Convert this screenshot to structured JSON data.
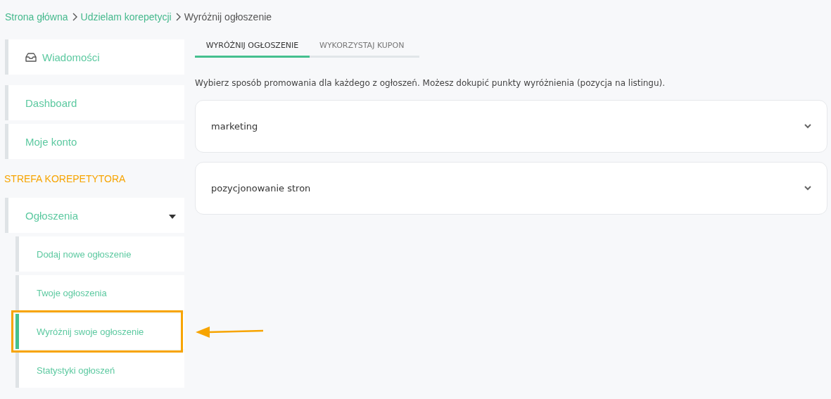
{
  "breadcrumb": [
    {
      "label": "Strona główna",
      "kind": "link"
    },
    {
      "label": "Udzielam korepetycji",
      "kind": "link"
    },
    {
      "label": "Wyróżnij ogłoszenie",
      "kind": "current"
    }
  ],
  "sidebar": [
    {
      "kind": "item",
      "label": "Wiadomości"
    },
    {
      "kind": "item",
      "label": "Dashboard"
    },
    {
      "kind": "item",
      "label": "Moje konto"
    },
    {
      "kind": "section",
      "label": "STREFA KOREPETYTORA"
    },
    {
      "kind": "item",
      "label": "Ogłoszenia",
      "expanded": true,
      "children": [
        {
          "label": "Dodaj nowe ogłoszenie",
          "selected": false
        },
        {
          "label": "Twoje ogłoszenia",
          "selected": false
        },
        {
          "label": "Wyróżnij swoje ogłoszenie",
          "selected": true
        },
        {
          "label": "Statystyki ogłoszeń",
          "selected": false
        }
      ]
    }
  ],
  "tabs": [
    {
      "label": "WYRÓŻNIJ OGŁOSZENIE",
      "selected": true
    },
    {
      "label": "WYKORZYSTAJ KUPON",
      "selected": false
    }
  ],
  "description": "Wybierz sposób promowania dla każdego z ogłoszeń. Możesz dokupić punkty wyróżnienia (pozycja na listingu).",
  "listings": [
    {
      "title": "marketing",
      "expanded": false
    },
    {
      "title": "pozycjonowanie stron",
      "expanded": false
    }
  ]
}
